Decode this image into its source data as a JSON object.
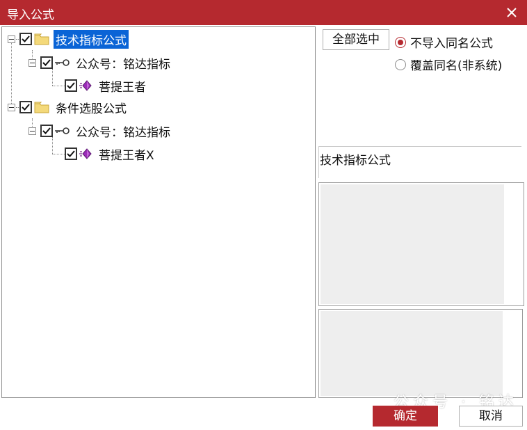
{
  "window": {
    "title": "导入公式",
    "accent_color": "#b5292f",
    "close_icon": "close-icon"
  },
  "tree": {
    "nodes": [
      {
        "label": "技术指标公式",
        "icon": "folder-icon",
        "checked": true,
        "selected": true
      },
      {
        "label": "公众号：铭达指标",
        "icon": "key-icon",
        "checked": true
      },
      {
        "label": "菩提王者",
        "icon": "gem-icon",
        "checked": true
      },
      {
        "label": "条件选股公式",
        "icon": "folder-icon",
        "checked": true
      },
      {
        "label": "公众号：铭达指标",
        "icon": "key-icon",
        "checked": true
      },
      {
        "label": "菩提王者X",
        "icon": "gem-icon",
        "checked": true
      }
    ]
  },
  "options": {
    "select_all_label": "全部选中",
    "radio_no_import_same": "不导入同名公式",
    "radio_overwrite_same": "覆盖同名(非系统)",
    "selected_radio": "不导入同名公式"
  },
  "info": {
    "title": "技术指标公式"
  },
  "buttons": {
    "ok_label": "确定",
    "cancel_label": "取消"
  },
  "watermark": {
    "text": "公众号 · 铭达"
  }
}
